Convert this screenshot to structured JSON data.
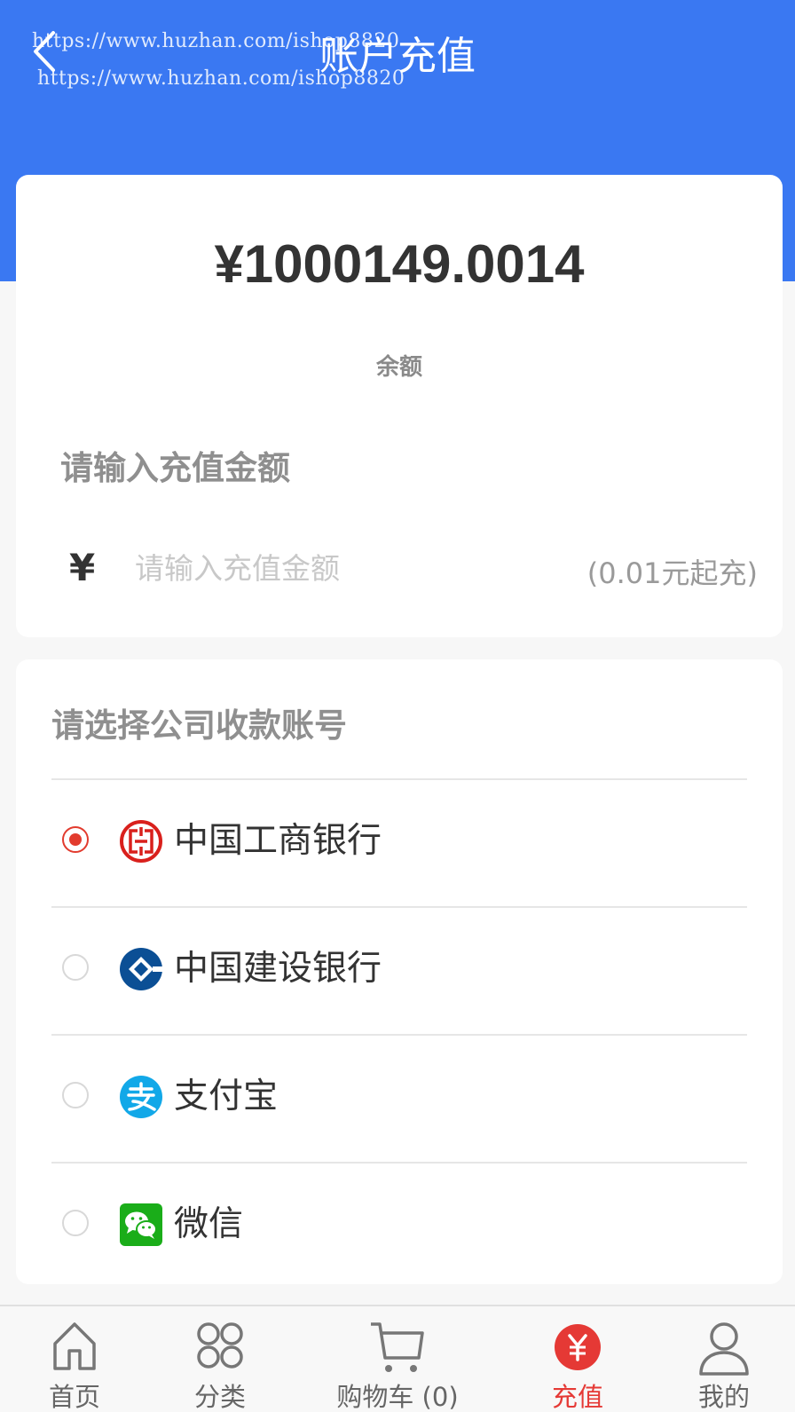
{
  "header": {
    "title": "账户充值",
    "watermark_line1": "https://www.huzhan.com/ishop8820",
    "watermark_line2": "https://www.huzhan.com/ishop8820"
  },
  "balance": {
    "amount": "¥1000149.0014",
    "label": "余额"
  },
  "recharge": {
    "title": "请输入充值金额",
    "currency_symbol": "¥",
    "input_placeholder": "请输入充值金额",
    "input_value": "",
    "hint": "(0.01元起充)"
  },
  "accounts": {
    "title": "请选择公司收款账号",
    "items": [
      {
        "name": "中国工商银行",
        "icon": "icbc-logo-icon",
        "selected": true
      },
      {
        "name": "中国建设银行",
        "icon": "ccb-logo-icon",
        "selected": false
      },
      {
        "name": "支付宝",
        "icon": "alipay-logo-icon",
        "selected": false
      },
      {
        "name": "微信",
        "icon": "wechat-logo-icon",
        "selected": false
      }
    ]
  },
  "nav": {
    "items": [
      {
        "label": "首页",
        "icon": "home-icon",
        "active": false
      },
      {
        "label": "分类",
        "icon": "category-icon",
        "active": false
      },
      {
        "label": "购物车 (0)",
        "icon": "cart-icon",
        "active": false
      },
      {
        "label": "充值",
        "icon": "recharge-icon",
        "active": true
      },
      {
        "label": "我的",
        "icon": "user-icon",
        "active": false
      }
    ]
  },
  "colors": {
    "header_blue": "#3a78f2",
    "accent_red": "#e53935",
    "icbc_red": "#d9201c",
    "ccb_blue": "#0b4f95",
    "alipay_blue": "#12a8e8",
    "wechat_green": "#1aad19"
  }
}
